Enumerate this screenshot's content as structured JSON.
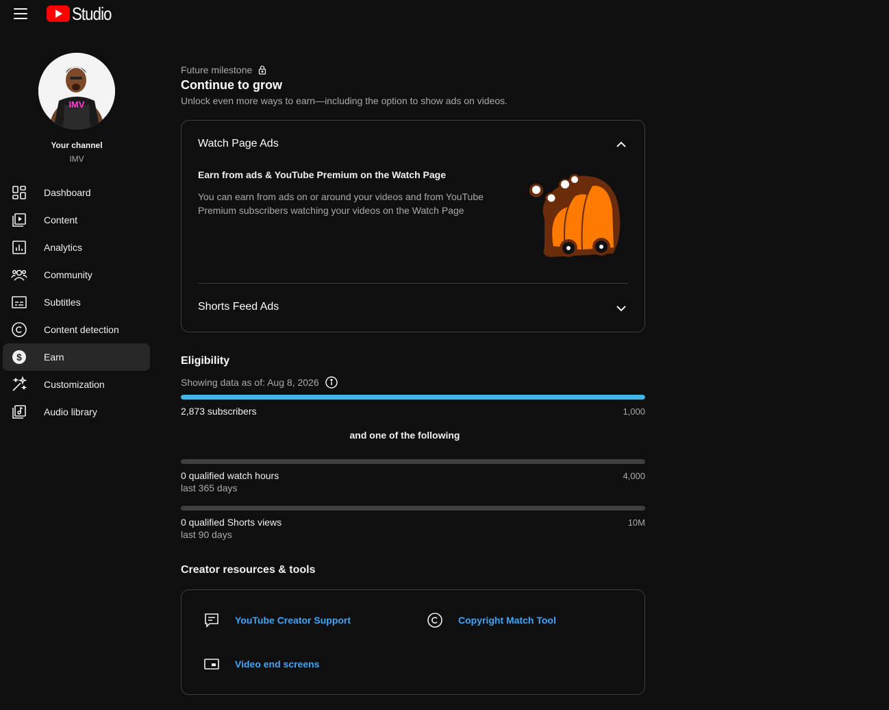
{
  "header": {
    "logo_text": "Studio"
  },
  "sidebar": {
    "channel_label": "Your channel",
    "channel_name": "IMV",
    "items": [
      {
        "label": "Dashboard",
        "icon": "dashboard-icon"
      },
      {
        "label": "Content",
        "icon": "content-icon"
      },
      {
        "label": "Analytics",
        "icon": "analytics-icon"
      },
      {
        "label": "Community",
        "icon": "community-icon"
      },
      {
        "label": "Subtitles",
        "icon": "subtitles-icon"
      },
      {
        "label": "Content detection",
        "icon": "copyright-icon"
      },
      {
        "label": "Earn",
        "icon": "dollar-icon",
        "active": true
      },
      {
        "label": "Customization",
        "icon": "magic-wand-icon"
      },
      {
        "label": "Audio library",
        "icon": "audio-library-icon"
      }
    ]
  },
  "milestone": {
    "label": "Future milestone",
    "title": "Continue to grow",
    "subtitle": "Unlock even more ways to earn—including the option to show ads on videos."
  },
  "ads": {
    "watch_title": "Watch Page Ads",
    "watch_subtitle": "Earn from ads & YouTube Premium on the Watch Page",
    "watch_body": "You can earn from ads on or around your videos and from YouTube Premium subscribers watching your videos on the Watch Page",
    "shorts_title": "Shorts Feed Ads"
  },
  "eligibility": {
    "title": "Eligibility",
    "date_text": "Showing data as of: Aug 8, 2026",
    "subscribers": {
      "label": "2,873 subscribers",
      "goal": "1,000",
      "progress": 1.0
    },
    "and_one": "and one of the following",
    "watch_hours": {
      "label": "0 qualified watch hours",
      "sub": "last 365 days",
      "goal": "4,000",
      "progress": 0
    },
    "shorts_views": {
      "label": "0 qualified Shorts views",
      "sub": "last 90 days",
      "goal": "10M",
      "progress": 0
    }
  },
  "resources": {
    "title": "Creator resources & tools",
    "support": "YouTube Creator Support",
    "copyright": "Copyright Match Tool",
    "end_screens": "Video end screens"
  },
  "colors": {
    "background": "#0f0f0f",
    "accent_blue": "#3ea6ff",
    "progress_fill": "#41b5e8",
    "brand_red": "#ff0000"
  }
}
